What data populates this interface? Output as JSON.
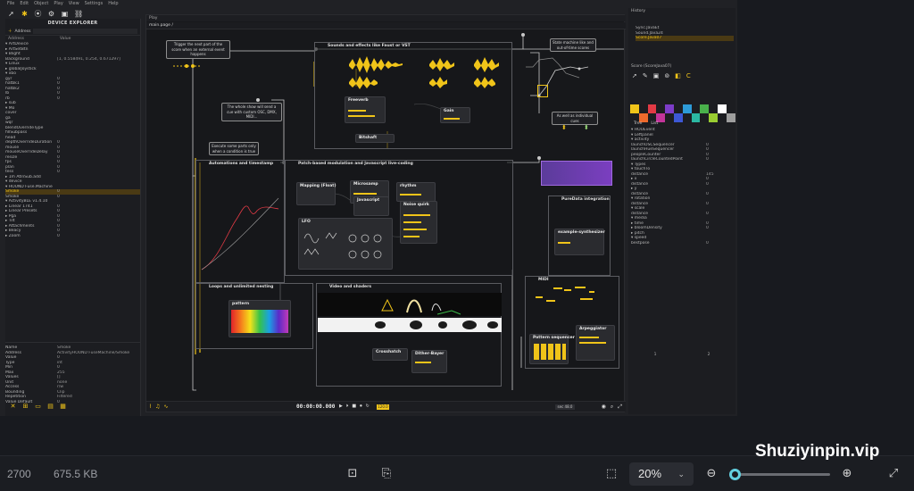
{
  "menubar": [
    "File",
    "Edit",
    "Object",
    "Play",
    "View",
    "Settings",
    "Help"
  ],
  "device_explorer": {
    "title": "DEVICE EXPLORER",
    "address_label": "Address",
    "col_address": "Address",
    "col_value": "Value",
    "rows": [
      {
        "k": "▾ ArtDevice",
        "v": ""
      },
      {
        "k": "  ▸ ArtSetBtn",
        "v": ""
      },
      {
        "k": "▾ Blight",
        "v": ""
      },
      {
        "k": "  Background",
        "v": "[1, 0.558491, 0.254, 0.671297]"
      },
      {
        "k": "▾ Linux",
        "v": ""
      },
      {
        "k": "  ▸ globalJoystick",
        "v": ""
      },
      {
        "k": "▾ xbo",
        "v": ""
      },
      {
        "k": "    gyr",
        "v": "0"
      },
      {
        "k": "    hatbk1",
        "v": "0"
      },
      {
        "k": "    hatbk2",
        "v": "0"
      },
      {
        "k": "    lb",
        "v": "0"
      },
      {
        "k": "    rb",
        "v": "0"
      },
      {
        "k": "  ▸ sub",
        "v": ""
      },
      {
        "k": "▾ Mo",
        "v": ""
      },
      {
        "k": "  cover",
        "v": ""
      },
      {
        "k": "  ga",
        "v": ""
      },
      {
        "k": "  wqr",
        "v": ""
      },
      {
        "k": "  blendOverrideType",
        "v": ""
      },
      {
        "k": "  fillSubpass",
        "v": ""
      },
      {
        "k": "  head",
        "v": ""
      },
      {
        "k": "  depthOverrideDuration",
        "v": "0"
      },
      {
        "k": "  mouse",
        "v": "0"
      },
      {
        "k": "  mouseOverrideDelay",
        "v": "0"
      },
      {
        "k": "  resize",
        "v": "0"
      },
      {
        "k": "  fps",
        "v": "0"
      },
      {
        "k": "  plan",
        "v": "0"
      },
      {
        "k": "  tess",
        "v": "0"
      },
      {
        "k": "  ▸ 1m AtlnSub.add",
        "v": ""
      },
      {
        "k": "▾ device",
        "v": ""
      },
      {
        "k": "  ▾ HOUND Fuse.Machine",
        "v": ""
      },
      {
        "k": "      Smoke",
        "v": "0",
        "sel": true
      },
      {
        "k": "      Smoke",
        "v": "0"
      },
      {
        "k": "  ▾ ActivityBLE v1.4.10",
        "v": ""
      },
      {
        "k": "    ▸ Linear 1741",
        "v": "0"
      },
      {
        "k": "    ▸ Linear Presets",
        "v": "0"
      },
      {
        "k": "    ▸ Pga",
        "v": "0"
      },
      {
        "k": "    ▸ Tilt",
        "v": "0"
      },
      {
        "k": "    ▸ Attachments",
        "v": "0"
      },
      {
        "k": "    ▸ Beacy",
        "v": "0"
      },
      {
        "k": "    ▸ Zoom",
        "v": "0"
      }
    ],
    "props": [
      {
        "k": "Name",
        "v": "Smoke"
      },
      {
        "k": "Address",
        "v": "ActivityHOUND FuseMachine/Smoke"
      },
      {
        "k": "Value",
        "v": "0"
      },
      {
        "k": "Type",
        "v": "int"
      },
      {
        "k": "Min",
        "v": "0"
      },
      {
        "k": "Max",
        "v": "255"
      },
      {
        "k": "Values",
        "v": "[]"
      },
      {
        "k": "Unit",
        "v": "none"
      },
      {
        "k": "Access",
        "v": "r/w"
      },
      {
        "k": "Bounding",
        "v": "Clip"
      },
      {
        "k": "Repetition",
        "v": "Filtered"
      },
      {
        "k": "Value Default",
        "v": "0"
      }
    ]
  },
  "canvas": {
    "tab": "Play",
    "breadcrumb": "main.page /",
    "notes": {
      "trigger": "Trigger the next part of the score when an external event happens",
      "osc": "The whole show will send a cue with custom OSC, DMX, MIDI...",
      "exec": "Execute some parts only when a condition is true",
      "state": "State machine like and out-of-time scores",
      "curve": "As well as individual cues"
    },
    "groups": {
      "sounds": "Sounds and effects like Faust or VST",
      "automation": "Automations and timestamp",
      "patch": "Patch-based modulation and Javascript live-coding",
      "loops": "Loops and unlimited nesting",
      "video": "Video and shaders",
      "puredata": "PureData integration",
      "midi": "MIDI"
    },
    "nodes": {
      "freeverb": "Freeverb",
      "gain": "Gain",
      "bitshaft": "Bitshaft",
      "mapping": "Mapping (Float)",
      "microsamp": "Microsamp",
      "javascript": "Javascript",
      "rhythm": "rhythm",
      "noise": "Noise quirk",
      "lfo": "LFO",
      "pattern": "pattern",
      "crosshatch": "Crosshatch",
      "dither": "Dither-Bayer",
      "pattern_seq": "Pattern sequencer",
      "arpeggiator": "Arpeggiator",
      "puredata_node": "example-synthesizer"
    },
    "transport": {
      "time": "00:00:00.000",
      "tempo": "120.0",
      "latency": "sec 48.0"
    }
  },
  "right_panel": {
    "history": "History",
    "history_items": [
      "Sync.JavaEt",
      "Sound.Java24",
      "Score.Java07"
    ],
    "state_header": "Score (ScoreJava07)",
    "tabs": [
      "Tree",
      "List"
    ],
    "col_address": "Address",
    "col_value": "Value",
    "rows": [
      {
        "k": "▾ HOUEvent",
        "v": ""
      },
      {
        "k": "  ▾ Leftpanel",
        "v": ""
      },
      {
        "k": "    ▾ activity",
        "v": ""
      },
      {
        "k": "      launchOSCSequencer",
        "v": "0"
      },
      {
        "k": "      launchHueSequencer",
        "v": "0"
      },
      {
        "k": "      peopleCounter",
        "v": "0"
      },
      {
        "k": "      launchCircleCountedPoint",
        "v": "0"
      },
      {
        "k": "  ▾ Types",
        "v": ""
      },
      {
        "k": "    ▾ touchTo",
        "v": ""
      },
      {
        "k": "        distance",
        "v": "145"
      },
      {
        "k": "      ▸ x",
        "v": "0"
      },
      {
        "k": "        distance",
        "v": "0"
      },
      {
        "k": "      ▸ y",
        "v": ""
      },
      {
        "k": "        distance",
        "v": "0"
      },
      {
        "k": "    ▾ rotation",
        "v": ""
      },
      {
        "k": "        distance",
        "v": "0"
      },
      {
        "k": "    ▾ scale",
        "v": ""
      },
      {
        "k": "        distance",
        "v": "0"
      },
      {
        "k": "    ▾ media",
        "v": ""
      },
      {
        "k": "      ▸ time",
        "v": "0"
      },
      {
        "k": "      ▸ bloomDensity",
        "v": "0"
      },
      {
        "k": "      ▸ pitch",
        "v": ""
      },
      {
        "k": "    ▾ speed",
        "v": ""
      },
      {
        "k": "        bestpose",
        "v": "0"
      }
    ],
    "footer": [
      "1",
      "2"
    ],
    "palette": [
      "#f0c419",
      "#ee6a2c",
      "#e23a45",
      "#c3349a",
      "#7d3cc8",
      "#3d58d6",
      "#2d9bd8",
      "#2bb8a3",
      "#49b04b",
      "#9acd32",
      "#ffffff",
      "#9e9e9e"
    ]
  },
  "viewer": {
    "dimension": "2700",
    "file_size": "675.5 KB",
    "zoom": "20%",
    "watermark": "Shuziyinpin.vip"
  }
}
